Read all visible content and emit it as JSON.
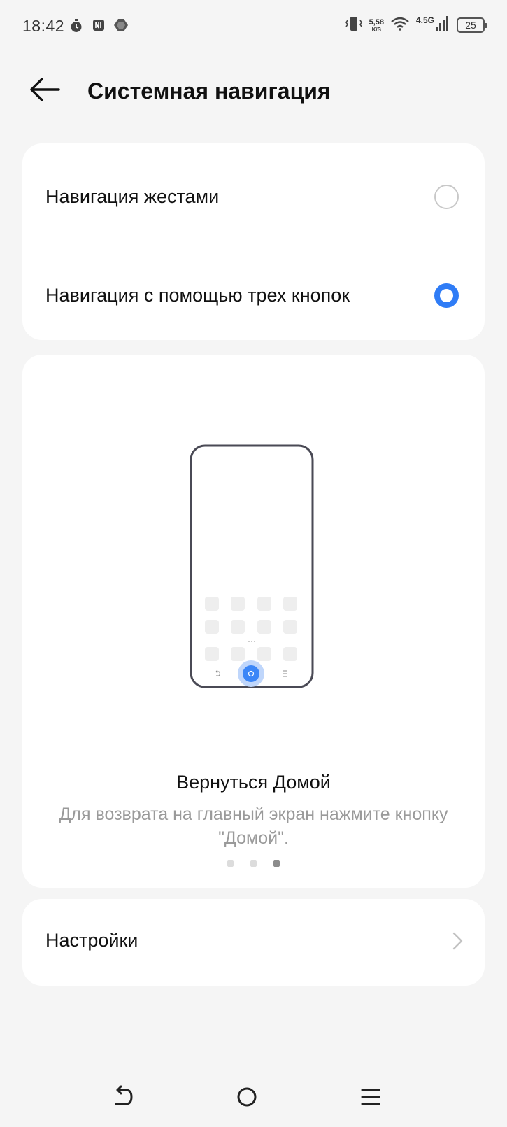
{
  "status_bar": {
    "time": "18:42",
    "net_speed_value": "5,58",
    "net_speed_unit": "K/S",
    "network_type": "4.5G",
    "battery_level": "25"
  },
  "header": {
    "title": "Системная навигация",
    "back_icon": "arrow-left-icon"
  },
  "options": {
    "gesture_label": "Навигация жестами",
    "gesture_selected": false,
    "three_button_label": "Навигация с помощью трех кнопок",
    "three_button_selected": true
  },
  "preview": {
    "title": "Вернуться Домой",
    "description": "Для возврата на главный экран нажмите кнопку \"Домой\".",
    "page_count": 3,
    "active_page": 3
  },
  "settings": {
    "label": "Настройки",
    "chevron_icon": "chevron-right-icon"
  },
  "system_nav": {
    "back_icon": "back-icon",
    "home_icon": "home-icon",
    "recents_icon": "menu-icon"
  },
  "colors": {
    "accent": "#2f7cf6",
    "background": "#f5f5f5",
    "card": "#ffffff",
    "secondary_text": "#9a9a9a"
  }
}
